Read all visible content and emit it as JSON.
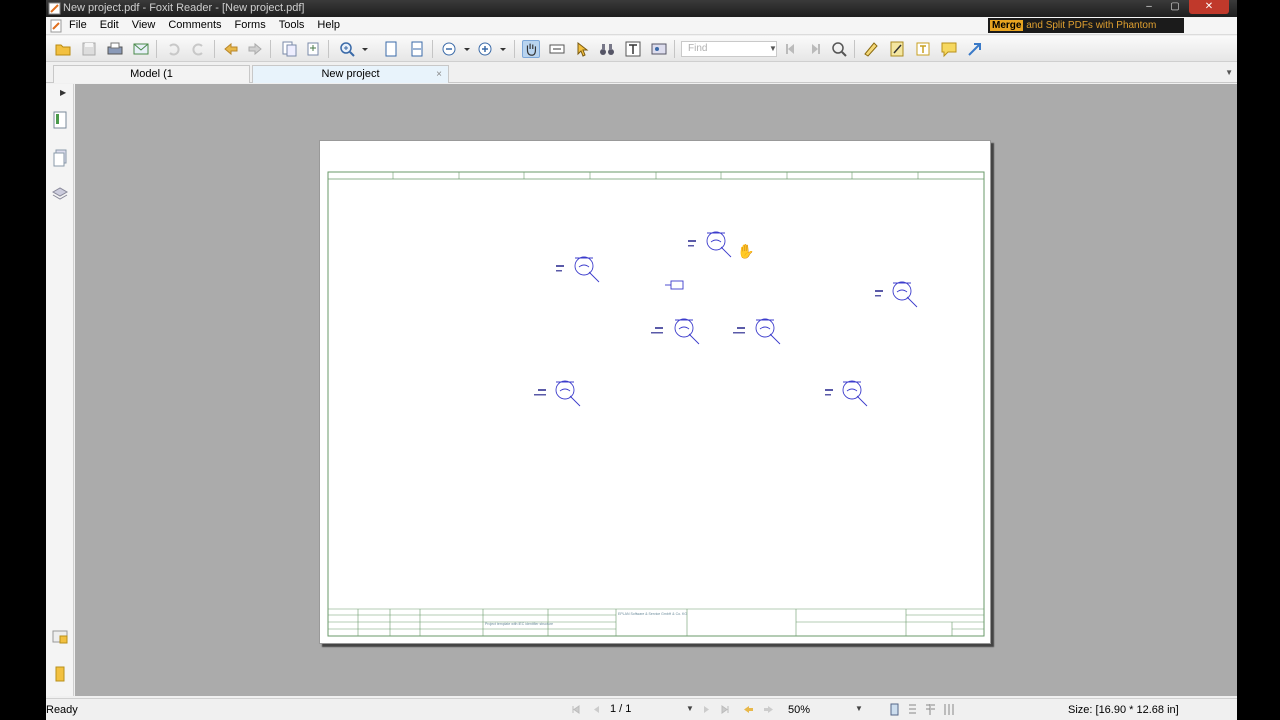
{
  "window": {
    "title": "New project.pdf - Foxit Reader - [New project.pdf]",
    "min_symbol": "‒",
    "max_symbol": "▢",
    "close_symbol": "✕"
  },
  "ad": {
    "merge": "Merge",
    "text": "and Split PDFs with Phantom"
  },
  "menu": [
    "File",
    "Edit",
    "View",
    "Comments",
    "Forms",
    "Tools",
    "Help"
  ],
  "toolbar": {
    "find_placeholder": "Find"
  },
  "tabs": [
    {
      "label": "Model (1",
      "close": ""
    },
    {
      "label": "New project",
      "close": "×"
    }
  ],
  "document": {
    "title_block": {
      "company": "EPLAN Software & Service GmbH & Co. KG",
      "description": "Project template with IEC identifier structure"
    }
  },
  "status": {
    "text": "Ready",
    "page": "1 / 1",
    "zoom": "50%",
    "size": "Size: [16.90 * 12.68 in]"
  },
  "colors": {
    "accent": "#e8a420",
    "schematic": "#3c3ccc",
    "frame": "#6a9a6a",
    "workspace": "#ababab"
  }
}
